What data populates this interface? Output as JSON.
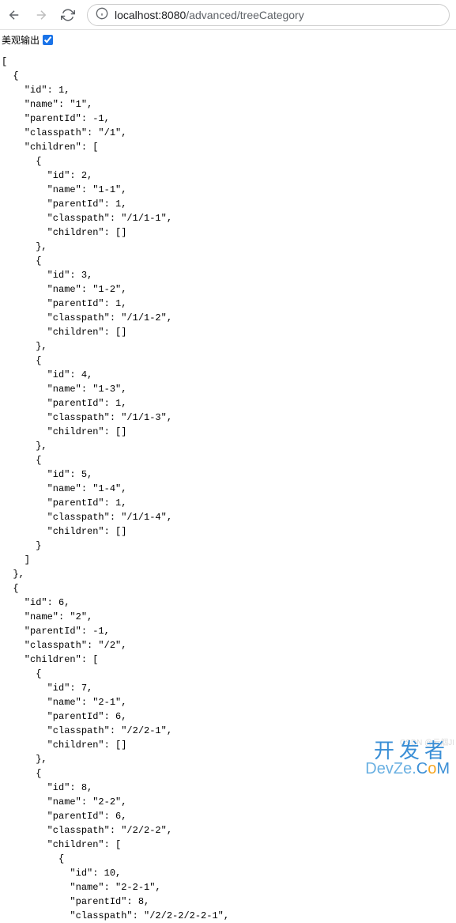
{
  "toolbar": {
    "url_host": "localhost:8080",
    "url_path": "/advanced/treeCategory"
  },
  "options": {
    "pretty_label": "美观输出",
    "pretty_checked": true
  },
  "watermark": {
    "line1": "开发者",
    "line2_prefix": "DevZe.",
    "line2_c": "C",
    "line2_o": "o",
    "line2_m": "M"
  },
  "json_tree": [
    {
      "id": 1,
      "name": "1",
      "parentId": -1,
      "classpath": "/1",
      "children": [
        {
          "id": 2,
          "name": "1-1",
          "parentId": 1,
          "classpath": "/1/1-1",
          "children": []
        },
        {
          "id": 3,
          "name": "1-2",
          "parentId": 1,
          "classpath": "/1/1-2",
          "children": []
        },
        {
          "id": 4,
          "name": "1-3",
          "parentId": 1,
          "classpath": "/1/1-3",
          "children": []
        },
        {
          "id": 5,
          "name": "1-4",
          "parentId": 1,
          "classpath": "/1/1-4",
          "children": []
        }
      ]
    },
    {
      "id": 6,
      "name": "2",
      "parentId": -1,
      "classpath": "/2",
      "children": [
        {
          "id": 7,
          "name": "2-1",
          "parentId": 6,
          "classpath": "/2/2-1",
          "children": []
        },
        {
          "id": 8,
          "name": "2-2",
          "parentId": 6,
          "classpath": "/2/2-2",
          "children": [
            {
              "id": 10,
              "name": "2-2-1",
              "parentId": 8,
              "classpath": "/2/2-2/2-2-1"
            }
          ]
        }
      ]
    }
  ],
  "rendered_lines": [
    "[",
    "  {",
    "    \"id\": 1,",
    "    \"name\": \"1\",",
    "    \"parentId\": -1,",
    "    \"classpath\": \"/1\",",
    "    \"children\": [",
    "      {",
    "        \"id\": 2,",
    "        \"name\": \"1-1\",",
    "        \"parentId\": 1,",
    "        \"classpath\": \"/1/1-1\",",
    "        \"children\": []",
    "      },",
    "      {",
    "        \"id\": 3,",
    "        \"name\": \"1-2\",",
    "        \"parentId\": 1,",
    "        \"classpath\": \"/1/1-2\",",
    "        \"children\": []",
    "      },",
    "      {",
    "        \"id\": 4,",
    "        \"name\": \"1-3\",",
    "        \"parentId\": 1,",
    "        \"classpath\": \"/1/1-3\",",
    "        \"children\": []",
    "      },",
    "      {",
    "        \"id\": 5,",
    "        \"name\": \"1-4\",",
    "        \"parentId\": 1,",
    "        \"classpath\": \"/1/1-4\",",
    "        \"children\": []",
    "      }",
    "    ]",
    "  },",
    "  {",
    "    \"id\": 6,",
    "    \"name\": \"2\",",
    "    \"parentId\": -1,",
    "    \"classpath\": \"/2\",",
    "    \"children\": [",
    "      {",
    "        \"id\": 7,",
    "        \"name\": \"2-1\",",
    "        \"parentId\": 6,",
    "        \"classpath\": \"/2/2-1\",",
    "        \"children\": []",
    "      },",
    "      {",
    "        \"id\": 8,",
    "        \"name\": \"2-2\",",
    "        \"parentId\": 6,",
    "        \"classpath\": \"/2/2-2\",",
    "        \"children\": [",
    "          {",
    "            \"id\": 10,",
    "            \"name\": \"2-2-1\",",
    "            \"parentId\": 8,",
    "            \"classpath\": \"/2/2-2/2-2-1\","
  ]
}
